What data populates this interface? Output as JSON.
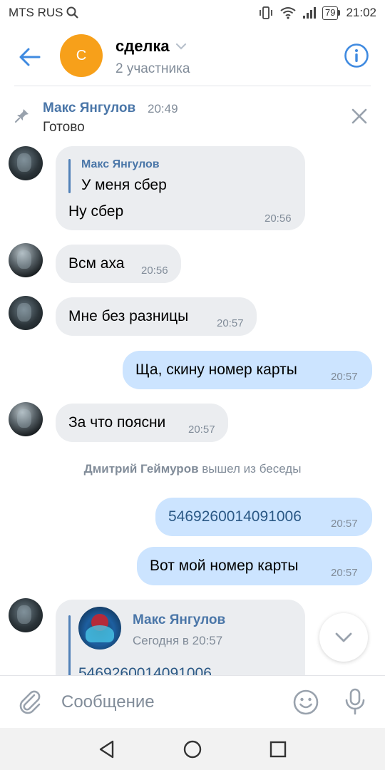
{
  "status_bar": {
    "carrier": "MTS RUS",
    "battery": "79",
    "time": "21:02"
  },
  "header": {
    "avatar_letter": "С",
    "title": "сделка",
    "subtitle": "2 участника",
    "accent_color": "#4a76a8",
    "avatar_color": "#f7a01a"
  },
  "pinned": {
    "author": "Макс Янгулов",
    "time": "20:49",
    "text": "Готово"
  },
  "messages": [
    {
      "direction": "in",
      "reply_author": "Макс Янгулов",
      "reply_text": "У меня сбер",
      "text": "Ну сбер",
      "time": "20:56"
    },
    {
      "direction": "in",
      "text": "Всм аха",
      "time": "20:56"
    },
    {
      "direction": "in",
      "text": "Мне без разницы",
      "time": "20:57"
    },
    {
      "direction": "out",
      "text": "Ща, скину номер карты",
      "time": "20:57"
    },
    {
      "direction": "in",
      "text": "За что поясни",
      "time": "20:57"
    },
    {
      "direction": "service",
      "name": "Дмитрий Геймуров",
      "action": "вышел из беседы"
    },
    {
      "direction": "out",
      "text": "5469260014091006",
      "time": "20:57"
    },
    {
      "direction": "out",
      "text": "Вот мой номер карты",
      "time": "20:57"
    },
    {
      "direction": "in",
      "forward_author": "Макс Янгулов",
      "forward_time": "Сегодня в 20:57",
      "forward_text": "5469260014091006"
    }
  ],
  "composer": {
    "placeholder": "Сообщение"
  },
  "icons": {
    "back": "arrow-left-icon",
    "info": "info-circle-icon",
    "pin": "pin-icon",
    "close": "close-icon",
    "attach": "paperclip-icon",
    "emoji": "smiley-icon",
    "mic": "microphone-icon",
    "scroll_down": "chevron-down-icon"
  }
}
